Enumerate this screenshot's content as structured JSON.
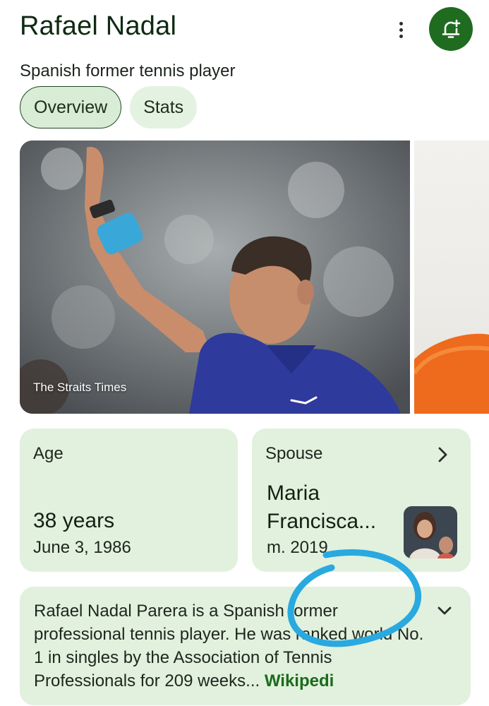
{
  "header": {
    "title": "Rafael Nadal",
    "subtitle": "Spanish former tennis player"
  },
  "actions": {
    "more_icon": "more-vert-icon",
    "follow_icon": "bell-plus-icon",
    "follow_color": "#1f6b1f"
  },
  "tabs": [
    {
      "label": "Overview",
      "active": true
    },
    {
      "label": "Stats",
      "active": false
    }
  ],
  "carousel": {
    "images": [
      {
        "credit": "The Straits Times"
      }
    ]
  },
  "facts": {
    "age": {
      "label": "Age",
      "value": "38 years",
      "sub": "June 3, 1986"
    },
    "spouse": {
      "label": "Spouse",
      "value": "Maria Francisca...",
      "sub": "m. 2019"
    }
  },
  "description": {
    "text": "Rafael Nadal Parera is a Spanish former professional tennis player. He was ranked world No. 1 in singles by the Association of Tennis Professionals for 209 weeks...",
    "source": "Wikipedi"
  },
  "colors": {
    "card_bg": "#e1f1dd",
    "accent": "#1f6b1f",
    "annotation": "#29a9e0"
  }
}
